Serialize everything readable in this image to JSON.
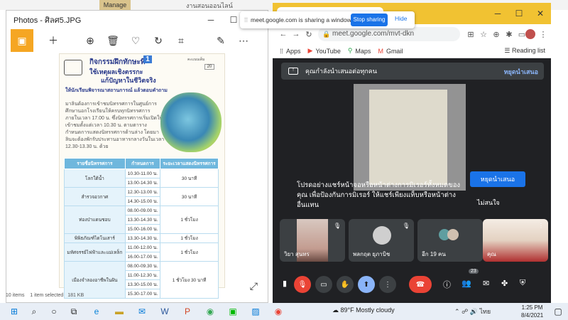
{
  "background_app": {
    "manage_label": "Manage",
    "title": "งานสอนออนไลน์"
  },
  "photos": {
    "title": "Photos - ศิลศ5.JPG",
    "status_items": "10 items",
    "status_selected": "1 item selected",
    "status_size": "181 KB",
    "toolbar_icons": [
      "thumbnail-icon",
      "add-icon",
      "zoom-icon",
      "delete-icon",
      "heart-icon",
      "rotate-icon",
      "crop-icon",
      "edit-icon",
      "more-icon"
    ],
    "worksheet": {
      "heading1": "กิจกรรมฝึกทักษะที่",
      "heading_num": "1",
      "heading2": "ใช้เหตุผลเชิงตรรกะ",
      "heading3": "แก้ปัญหาในชีวิตจริง",
      "score_label": "คะแนนเต็ม",
      "score_value": "20",
      "instruction": "ให้นักเรียนพิจารณาสถานการณ์ แล้วตอบคำถาม",
      "body": "มาลินต้องการเข้าชมนิทรรศการในศูนย์การศึกษานอกโรงเรียนให้ครบทุกนิทรรศการภายในเวลา 17.00 น. ซึ่งนิทรรศการเริ่มเปิดให้เข้าชมตั้งแต่เวลา 10.30 น. ตามตารางกำหนดการแสดงนิทรรศการด้านล่าง โดยมาลินจะต้องพักรับประทานอาหารกลางวันในเวลา 12.30-13.30 น. ด้วย",
      "table_headers": [
        "รายชื่อนิทรรศการ",
        "กำหนดการ",
        "ระยะเวลาแสดงนิทรรศการ"
      ],
      "table_rows": [
        {
          "name": "โลกใต้น้ำ",
          "times": [
            "10.30-11.00 น.",
            "13.00-14.30 น."
          ],
          "duration": "30 นาที"
        },
        {
          "name": "สำรวจอวกาศ",
          "times": [
            "12.30-13.00 น.",
            "14.30-15.00 น."
          ],
          "duration": "30 นาที"
        },
        {
          "name": "ท่องป่าแดนชอบ",
          "times": [
            "08.00-09.00 น.",
            "13.30-14.30 น.",
            "15.00-16.00 น."
          ],
          "duration": "1 ชั่วโมง"
        },
        {
          "name": "พิพิธภัณฑ์ไดโนเสาร์",
          "times": [
            "13.30-14.30 น."
          ],
          "duration": "1 ชั่วโมง"
        },
        {
          "name": "มหัศจรรย์ไฟฟ้าและแม่เหล็ก",
          "times": [
            "11.00-12.00 น.",
            "16.00-17.00 น."
          ],
          "duration": "1 ชั่วโมง"
        },
        {
          "name": "เมืองจำลองอาชีพในฝัน",
          "times": [
            "08.00-09.30 น.",
            "11.00-12.30 น.",
            "13.30-15.00 น.",
            "15.30-17.00 น."
          ],
          "duration": "1 ชั่วโมง 30 นาที"
        }
      ]
    }
  },
  "share_banner": {
    "text": "meet.google.com is sharing a window.",
    "stop_label": "Stop sharing",
    "hide_label": "Hide"
  },
  "chrome": {
    "url": "meet.google.com/mvt-dkn",
    "bookmarks": [
      {
        "icon": "apps-icon",
        "label": "Apps"
      },
      {
        "icon": "youtube-icon",
        "label": "YouTube"
      },
      {
        "icon": "maps-icon",
        "label": "Maps"
      },
      {
        "icon": "gmail-icon",
        "label": "Gmail"
      }
    ],
    "reading_list": "Reading list"
  },
  "meet": {
    "present_text": "คุณกำลังนำเสนอต่อทุกคน",
    "present_stop": "หยุดนำเสนอ",
    "warning_text": "โปรดอย่างแชร์หน้าจอหรือหน้าต่างการมิเรอร์ทั้งหมดของคุณ เพื่อป้องกันการมิเรอร์ ให้แชร์เพียงแท็บหรือหน้าต่างอื่นแทน",
    "stop_present_button": "หยุดนำเสนอ",
    "dont_mind": "ไม่สนใจ",
    "tiles": [
      {
        "name": "วิยา สุนทร"
      },
      {
        "name": "พลกฤต ยุภาบิช"
      },
      {
        "name": "อีก 19 คน"
      },
      {
        "name": "คุณ"
      }
    ],
    "people_count": "23"
  },
  "taskbar": {
    "weather": "89°F  Mostly cloudy",
    "language": "ไทย",
    "time": "1:25 PM",
    "date": "8/4/2021"
  },
  "colors": {
    "accent_orange": "#f5a623",
    "chrome_tab_yellow": "#f1c232",
    "meet_dark": "#202124",
    "meet_blue": "#1a73e8",
    "end_call_red": "#ea4335"
  }
}
